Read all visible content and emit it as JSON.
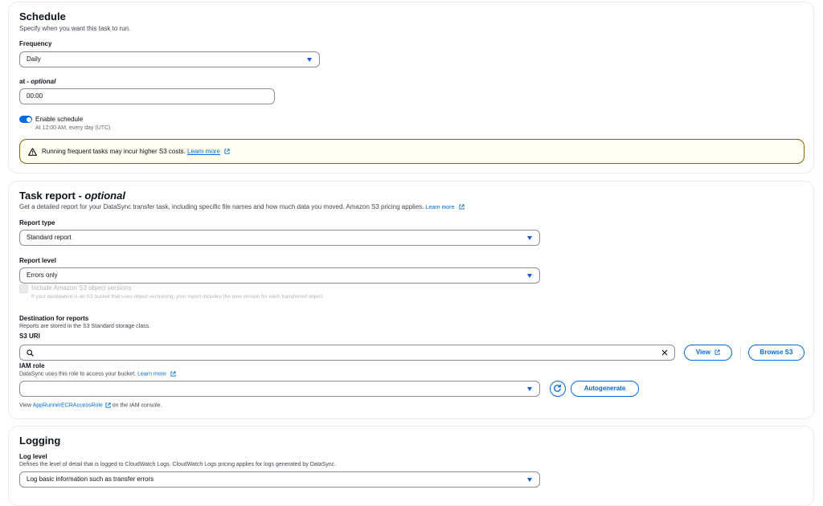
{
  "schedule": {
    "title": "Schedule",
    "description": "Specify when you want this task to run.",
    "frequency_label": "Frequency",
    "frequency_value": "Daily",
    "at_label": "at - ",
    "at_optional": "optional",
    "at_value": "00:00",
    "enable_label": "Enable schedule",
    "enable_sub": "At 12:00 AM, every day (UTC)",
    "warning_text": "Running frequent tasks may incur higher S3 costs.",
    "warning_link": "Learn more"
  },
  "task_report": {
    "title": "Task report - ",
    "title_optional": "optional",
    "description": "Get a detailed report for your DataSync transfer task, including specific file names and how much data you moved. Amazon S3 pricing applies.",
    "learn_more": "Learn more",
    "report_type_label": "Report type",
    "report_type_value": "Standard report",
    "report_level_label": "Report level",
    "report_level_value": "Errors only",
    "include_versions_label": "Include Amazon S3 object versions",
    "include_versions_sub": "If your destination is an S3 bucket that uses object versioning, your report includes the new version for each transferred object.",
    "destination_label": "Destination for reports",
    "destination_sub": "Reports are stored in the S3 Standard storage class.",
    "s3_uri_label": "S3 URI",
    "s3_uri_value": "",
    "view_button": "View",
    "browse_button": "Browse S3",
    "iam_label": "IAM role",
    "iam_sub": "DataSync uses this role to access your bucket.",
    "iam_learn_more": "Learn more",
    "iam_value": "",
    "autogenerate_button": "Autogenerate",
    "view_prefix": "View ",
    "role_link": "AppRunnerECRAccessRole",
    "view_suffix": " on the IAM console."
  },
  "logging": {
    "title": "Logging",
    "log_level_label": "Log level",
    "log_level_sub": "Defines the level of detail that is logged to CloudWatch Logs. CloudWatch Logs pricing applies for logs generated by DataSync.",
    "log_level_value": "Log basic information such as transfer errors"
  },
  "colors": {
    "accent": "#006ce0",
    "warning_bg": "#fffef0",
    "warning_border": "#8d6605"
  }
}
